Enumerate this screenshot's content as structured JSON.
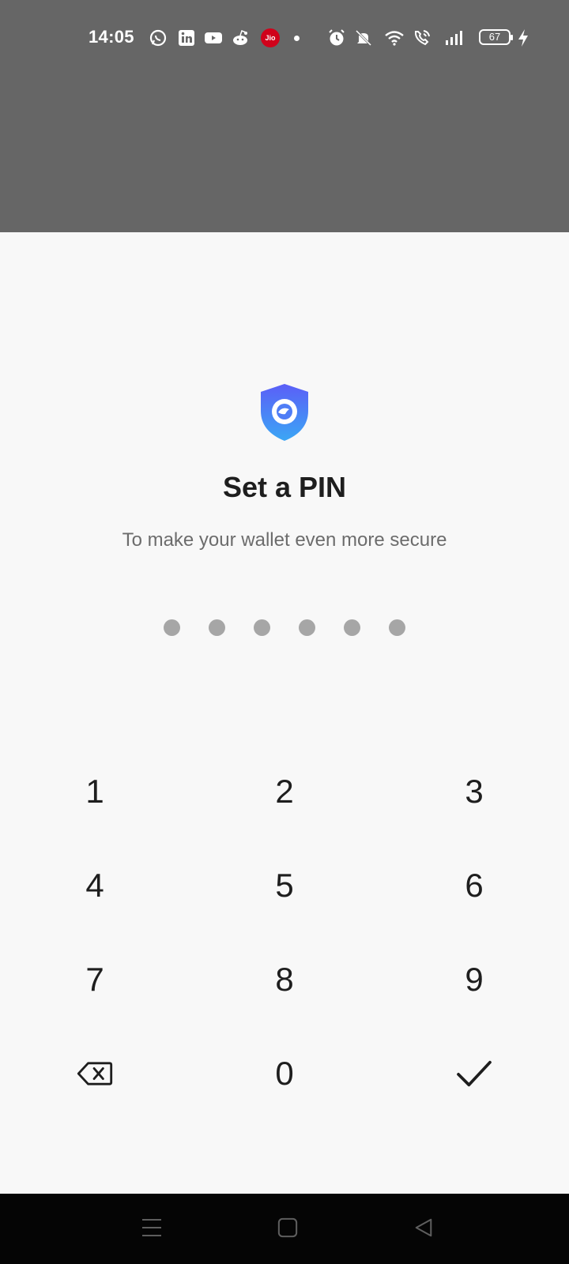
{
  "status_bar": {
    "time": "14:05",
    "jio_label": "Jio",
    "battery_level": "67",
    "icons": [
      "whatsapp-icon",
      "linkedin-icon",
      "youtube-icon",
      "reddit-icon",
      "jio-icon",
      "more-notifications-dot",
      "alarm-icon",
      "mute-icon",
      "wifi-icon",
      "wifi-calling-icon",
      "signal-icon",
      "battery-icon",
      "charging-icon"
    ]
  },
  "pin_setup": {
    "logo_icon": "shield-icon",
    "title": "Set a PIN",
    "subtitle": "To make your wallet even more secure",
    "pin_length": 6,
    "entered_digits": 0
  },
  "keypad": {
    "keys": [
      "1",
      "2",
      "3",
      "4",
      "5",
      "6",
      "7",
      "8",
      "9",
      "0"
    ],
    "backspace_icon": "backspace-icon",
    "confirm_icon": "checkmark-icon"
  },
  "nav_bar": {
    "icons": [
      "menu-icon",
      "home-icon",
      "back-icon"
    ]
  },
  "colors": {
    "overlay": "#666666",
    "background": "#f8f8f8",
    "pin_dot": "#a6a6a6",
    "shield_gradient_top": "#5b5ef7",
    "shield_gradient_bottom": "#3ba6f5",
    "text_primary": "#1e1e1e",
    "text_secondary": "#6c6c6c"
  }
}
